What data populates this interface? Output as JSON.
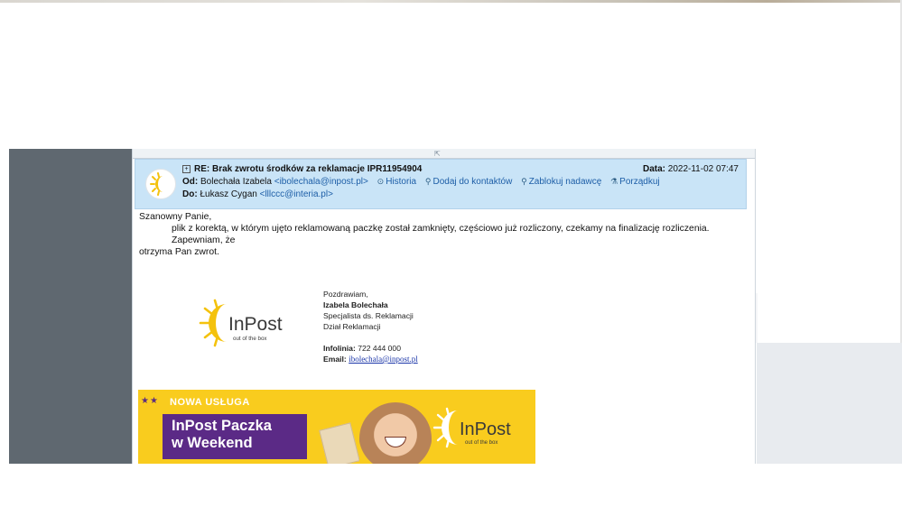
{
  "email": {
    "subject": "RE: Brak zwrotu środków za reklamacje IPR11954904",
    "date_label": "Data:",
    "date_value": "2022-11-02 07:47",
    "from_label": "Od:",
    "from_name": "Bolechała Izabela",
    "from_email": "<ibolechala@inpost.pl>",
    "actions": [
      "Historia",
      "Dodaj do kontaktów",
      "Zablokuj nadawcę",
      "Porządkuj"
    ],
    "to_label": "Do:",
    "to_name": "Łukasz Cygan",
    "to_email": "<lllccc@interia.pl>"
  },
  "body": {
    "greeting": "Szanowny Panie,",
    "line1": "plik z korektą, w którym ujęto reklamowaną paczkę został zamknięty, częściowo już rozliczony, czekamy na finalizację rozliczenia. Zapewniam, że",
    "line2": "otrzyma Pan zwrot."
  },
  "signature": {
    "closing": "Pozdrawiam,",
    "name": "Izabela Bolechała",
    "position": "Specjalista ds. Reklamacji",
    "department": "Dział Reklamacji",
    "hotline_label": "Infolinia:",
    "hotline": "722 444 000",
    "email_label": "Email:",
    "email": "ibolechala@inpost.pl",
    "logo_text": "InPost",
    "logo_tagline": "out of the box"
  },
  "banner": {
    "label": "NOWA USŁUGA",
    "headline_1": "InPost Paczka",
    "headline_2": "w Weekend",
    "logo_text": "InPost",
    "logo_tagline": "out of the box",
    "colors": {
      "yellow": "#f9cc1e",
      "purple": "#5b2a86"
    }
  },
  "icons": [
    "grip-icon",
    "expand-icon",
    "history-icon",
    "add-contact-icon",
    "block-icon",
    "organize-icon",
    "inpost-sun-logo"
  ]
}
